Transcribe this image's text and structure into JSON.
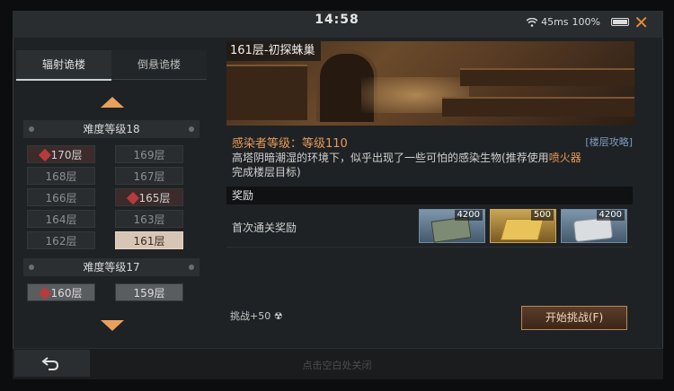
{
  "status_bar": {
    "time": "14:58",
    "latency": "45ms",
    "battery": "100%"
  },
  "tabs": [
    {
      "label": "辐射诡楼"
    },
    {
      "label": "倒悬诡楼"
    }
  ],
  "levels": [
    {
      "header": "难度等级18",
      "floors": [
        {
          "label": "170层"
        },
        {
          "label": "169层"
        },
        {
          "label": "168层"
        },
        {
          "label": "167层"
        },
        {
          "label": "166层"
        },
        {
          "label": "165层"
        },
        {
          "label": "164层"
        },
        {
          "label": "163层"
        },
        {
          "label": "162层"
        },
        {
          "label": "161层"
        }
      ]
    },
    {
      "header": "难度等级17",
      "floors": [
        {
          "label": "160层"
        },
        {
          "label": "159层"
        }
      ]
    }
  ],
  "detail": {
    "title": "161层-初探蛛巢",
    "infected_level": "感染者等级：等级110",
    "guide_link": "[楼层攻略]",
    "description_a": "高塔阴暗潮湿的环境下，似乎出现了一些可怕的感染生物(推荐使用",
    "description_highlight": "喷火器",
    "description_b": "完成楼层目标)",
    "reward_title": "奖励",
    "reward_label": "首次通关奖励",
    "rewards": [
      {
        "qty": "4200",
        "icon": "cash-bundle-icon"
      },
      {
        "qty": "500",
        "icon": "gold-bars-icon"
      },
      {
        "qty": "4200",
        "icon": "metal-ore-icon"
      }
    ],
    "challenge_cost": "挑战+50",
    "start_button": "开始挑战(F)"
  },
  "footer": {
    "tap_to_close": "点击空白处关闭"
  },
  "colors": {
    "accent": "#e59a5a",
    "close": "#e08a3a",
    "link": "#7f9bbd"
  }
}
